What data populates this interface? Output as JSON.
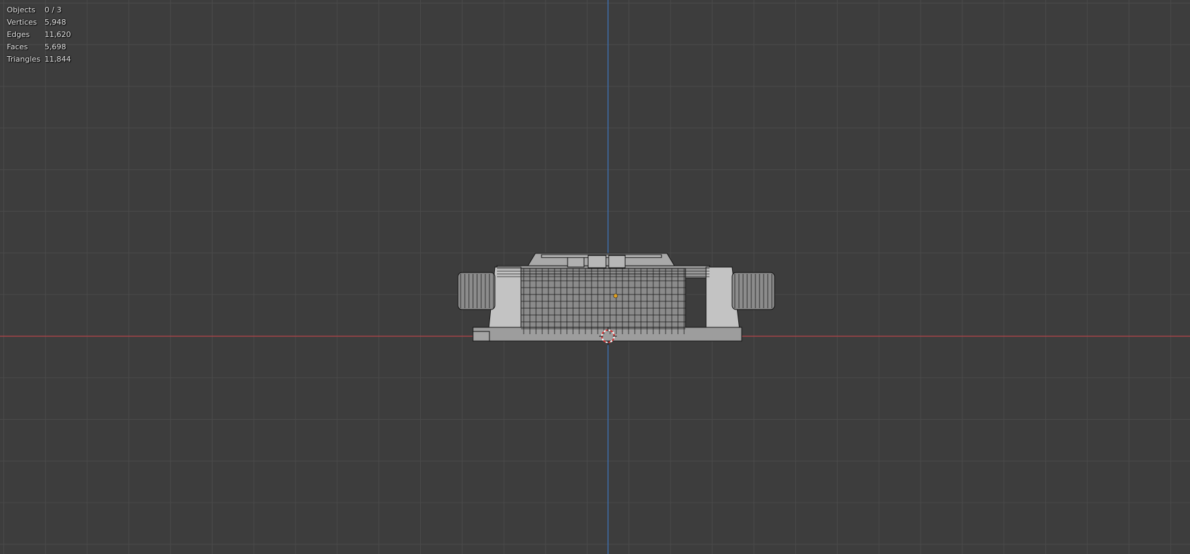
{
  "viewport": {
    "stats": [
      {
        "label": "Objects",
        "value": "0 / 3"
      },
      {
        "label": "Vertices",
        "value": "5,948"
      },
      {
        "label": "Edges",
        "value": "11,620"
      },
      {
        "label": "Faces",
        "value": "5,698"
      },
      {
        "label": "Triangles",
        "value": "11,844"
      }
    ],
    "colors": {
      "background": "#3d3d3d",
      "grid": "#4a4a4a",
      "x_axis": "#b5444a",
      "z_axis": "#3e6fb0",
      "mesh_fill": "#8f8f8f",
      "mesh_wire": "#111111",
      "origin": "#e0a020"
    }
  }
}
